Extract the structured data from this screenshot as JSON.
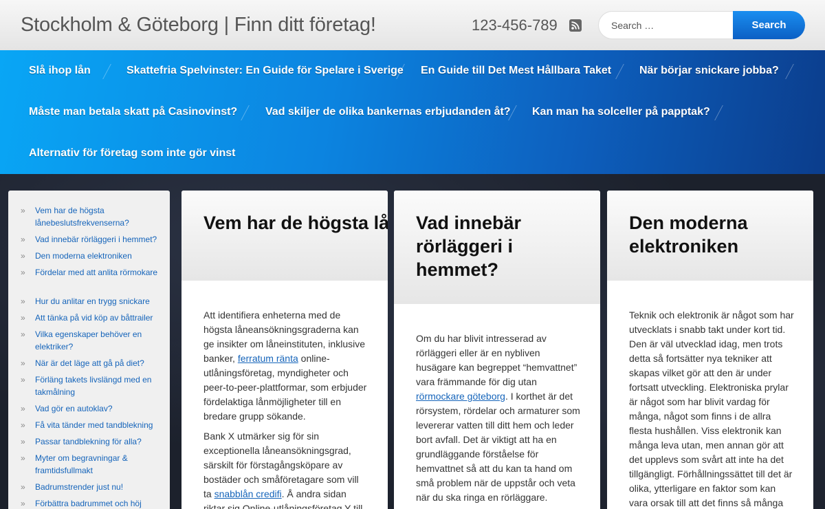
{
  "header": {
    "site_title": "Stockholm & Göteborg | Finn ditt företag!",
    "phone": "123-456-789",
    "search_placeholder": "Search …",
    "search_button": "Search"
  },
  "nav": {
    "items": [
      "Slå ihop lån",
      "Skattefria Spelvinster: En Guide för Spelare i Sverige",
      "En Guide till Det Mest Hållbara Taket",
      "När börjar snickare jobba?",
      "Måste man betala skatt på Casinovinst?",
      "Vad skiljer de olika bankernas erbjudanden åt?",
      "Kan man ha solceller på papptak?",
      "Alternativ för företag som inte gör vinst"
    ]
  },
  "sidebar": {
    "chevron": "»",
    "links": [
      "Vem har de högsta lånebeslutsfrekvenserna?",
      "Vad innebär rörläggeri i hemmet?",
      "Den moderna elektroniken",
      "Fördelar med att anlita rörmokare",
      "Hur du anlitar en trygg snickare",
      "Att tänka på vid köp av båttrailer",
      "Vilka egenskaper behöver en elektriker?",
      "När är det läge att gå på diet?",
      "Förläng takets livslängd med en takmålning",
      "Vad gör en autoklav?",
      "Få vita tänder med tandblekning",
      "Passar tandblekning för alla?",
      "Myter om begravningar & framtidsfullmakt",
      "Badrumstrender just nu!",
      "Förbättra badrummet och höj"
    ]
  },
  "posts": [
    {
      "title": "Vem har de högsta lånebeslutsfrekvenserna?",
      "p1_a": "Att identifiera enheterna med de högsta låneansökningsgraderna kan ge insikter om låneinstituten, inklusive banker, ",
      "p1_link": "ferratum ränta",
      "p1_b": " online-utlåningsföretag, myndigheter och peer-to-peer-plattformar, som erbjuder fördelaktiga lånmöjligheter till en bredare grupp sökande.",
      "p2_a": "Bank X utmärker sig för sin exceptionella låneansökningsgrad, särskilt för förstagångsköpare av bostäder och småföretagare som vill ta ",
      "p2_link": "snabblån credifi",
      "p2_b": ". Å andra sidan riktar sig Online-utlåningsföretag Y till"
    },
    {
      "title": "Vad innebär rörläggeri i hemmet?",
      "p1_a": "Om du har blivit intresserad av rörläggeri eller är en nybliven husägare kan begreppet “hemvattnet” vara främmande för dig utan ",
      "p1_link": "rörmockare göteborg",
      "p1_b": ". I korthet är det rörsystem, rördelar och armaturer som levererar vatten till ditt hem och leder bort avfall. Det är viktigt att ha en grundläggande förståelse för hemvattnet så att du kan ta hand om små problem när de uppstår och veta när du ska ringa en rörläggare."
    },
    {
      "title": "Den moderna elektroniken",
      "p1": "Teknik och elektronik är något som har utvecklats i snabb takt under kort tid. Den är väl utvecklad idag, men trots detta så fortsätter nya tekniker att skapas vilket gör att den är under fortsatt utveckling. Elektroniska prylar är något som har blivit vardag för många, något som finns i de allra flesta hushållen. Viss elektronik kan många leva utan, men annan gör att det upplevs som svårt att inte ha det tillgängligt. Förhållningssättet till det är olika, ytterligare en faktor som kan vara orsak till att det finns så många"
    }
  ]
}
